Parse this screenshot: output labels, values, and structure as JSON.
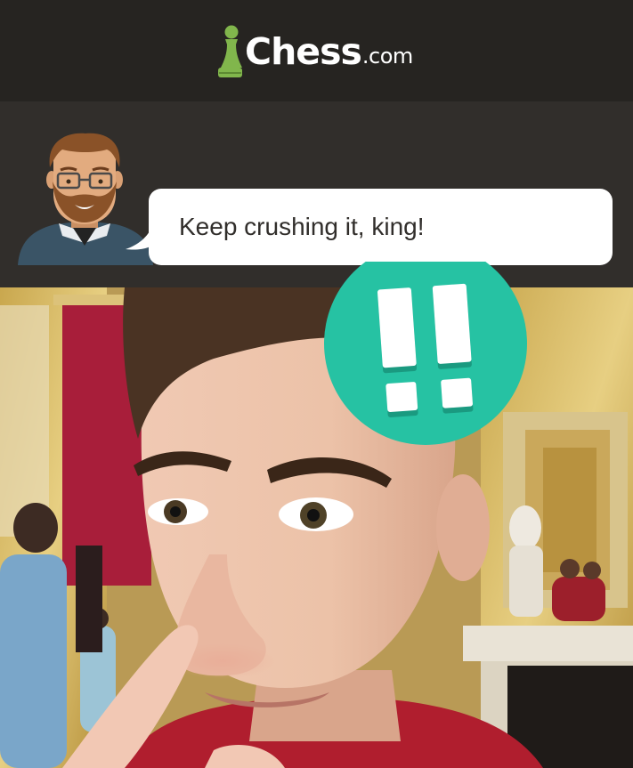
{
  "header": {
    "logo_main": "Chess",
    "logo_tld": ".com",
    "logo_icon": "pawn-icon"
  },
  "coach": {
    "avatar": "coach-avatar",
    "message": "Keep crushing it, king!"
  },
  "badge": {
    "icon": "brilliant-move-icon",
    "symbol": "!!",
    "color": "#26c2a3"
  },
  "colors": {
    "header_bg": "#262421",
    "panel_bg": "#312e2b",
    "brand_green": "#81b64c",
    "bubble_bg": "#ffffff",
    "bubble_text": "#312e2b"
  }
}
